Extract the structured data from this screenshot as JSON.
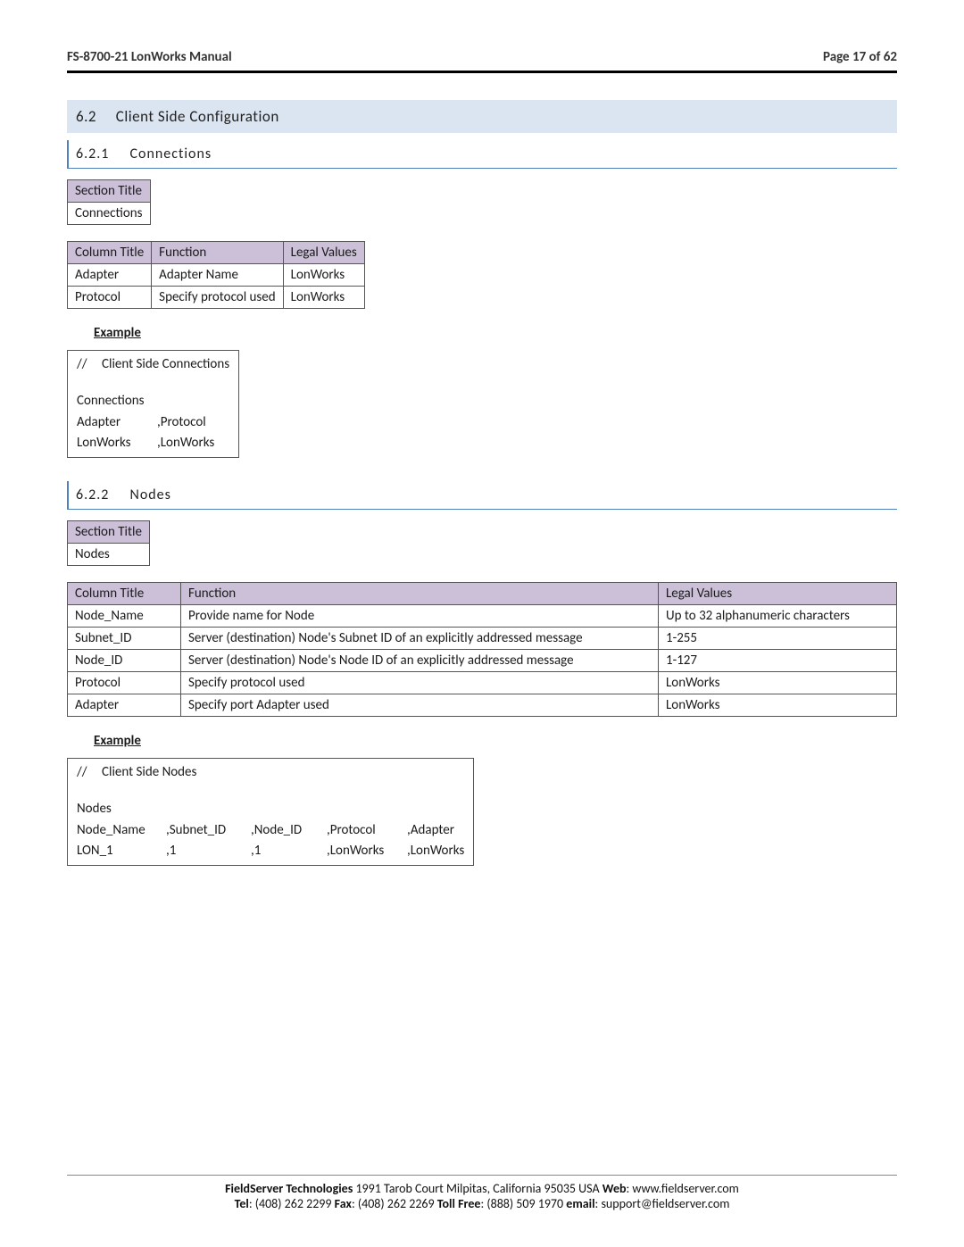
{
  "header": {
    "left": "FS-8700-21 LonWorks Manual",
    "right": "Page 17 of 62"
  },
  "s62": {
    "num": "6.2",
    "title": "Client Side Configuration"
  },
  "s621": {
    "num": "6.2.1",
    "title": "Connections",
    "sectionTitleLabel": "Section Title",
    "sectionTitleValue": "Connections",
    "colTitle": "Column Title",
    "funcTitle": "Function",
    "legalTitle": "Legal Values",
    "rows": [
      {
        "c0": "Adapter",
        "c1": "Adapter Name",
        "c2": "LonWorks"
      },
      {
        "c0": "Protocol",
        "c1": "Specify protocol used",
        "c2": "LonWorks"
      }
    ],
    "exampleLabel": "Example",
    "code": {
      "l1a": "//",
      "l1b": "Client Side Connections",
      "l2": "Connections",
      "l3a": "Adapter",
      "l3b": ",Protocol",
      "l4a": "LonWorks",
      "l4b": ",LonWorks"
    }
  },
  "s622": {
    "num": "6.2.2",
    "title": "Nodes",
    "sectionTitleLabel": "Section Title",
    "sectionTitleValue": "Nodes",
    "colTitle": "Column Title",
    "funcTitle": "Function",
    "legalTitle": "Legal Values",
    "rows": [
      {
        "c0": "Node_Name",
        "c1": "Provide name for Node",
        "c2": "Up to 32 alphanumeric characters"
      },
      {
        "c0": "Subnet_ID",
        "c1": "Server (destination) Node's Subnet ID of an explicitly addressed message",
        "c2": "1-255"
      },
      {
        "c0": "Node_ID",
        "c1": "Server (destination) Node's Node ID of an explicitly addressed message",
        "c2": "1-127"
      },
      {
        "c0": "Protocol",
        "c1": "Specify protocol used",
        "c2": "LonWorks"
      },
      {
        "c0": "Adapter",
        "c1": "Specify port Adapter used",
        "c2": "LonWorks"
      }
    ],
    "exampleLabel": "Example",
    "code": {
      "l1a": "//",
      "l1b": "Client Side Nodes",
      "l2": "Nodes",
      "hdr": [
        "Node_Name",
        ",Subnet_ID",
        ",Node_ID",
        ",Protocol",
        ",Adapter"
      ],
      "val": [
        "LON_1",
        ",1",
        ",1",
        ",LonWorks",
        ",LonWorks"
      ]
    }
  },
  "footer": {
    "company": "FieldServer Technologies",
    "addr": " 1991 Tarob Court Milpitas, California 95035 USA   ",
    "webL": "Web",
    "web": ": www.fieldserver.com",
    "telL": "Tel",
    "tel": ": (408) 262 2299   ",
    "faxL": "Fax",
    "fax": ": (408) 262 2269   ",
    "tollL": "Toll Free",
    "toll": ": (888) 509 1970   ",
    "emailL": "email",
    "email": ": support@fieldserver.com"
  }
}
